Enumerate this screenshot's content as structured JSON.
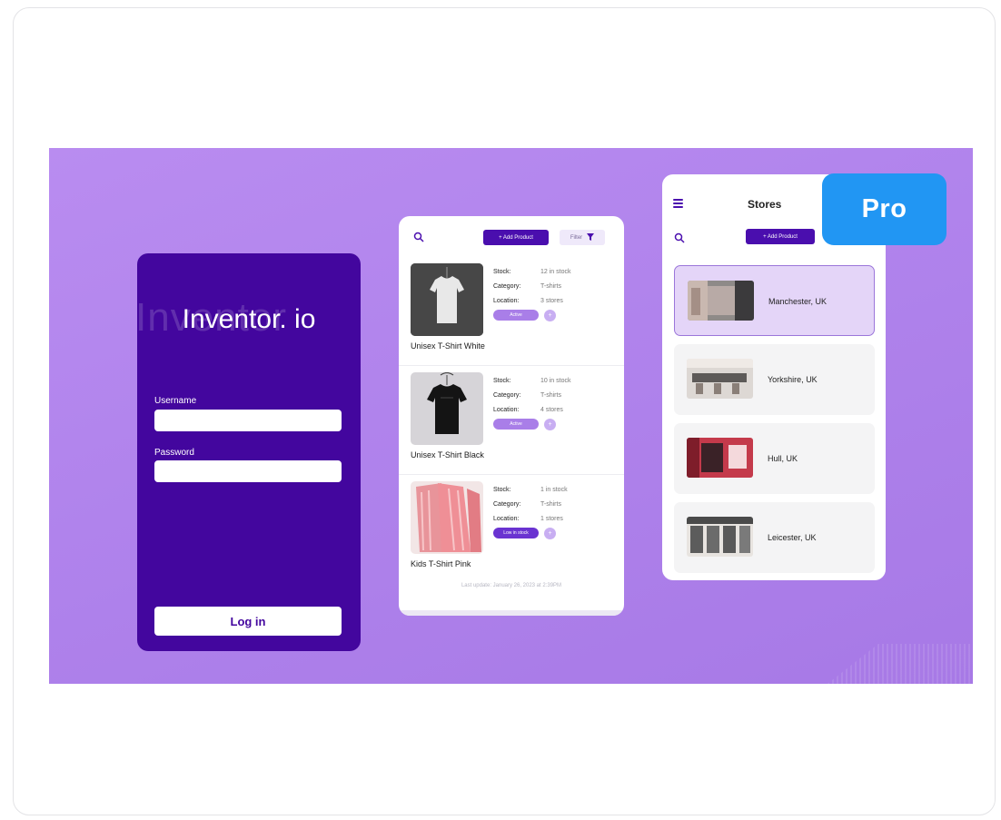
{
  "badge": {
    "label": "Pro"
  },
  "colors": {
    "banner": "#b083ec",
    "primary": "#43069e",
    "accent": "#4a0eae",
    "pro": "#2196f3"
  },
  "login": {
    "watermark": "Inventor",
    "title": "Inventor. io",
    "username_label": "Username",
    "username_value": "",
    "password_label": "Password",
    "password_value": "",
    "login_button": "Log in"
  },
  "products": {
    "search_icon": "search-icon",
    "add_button": "+ Add Product",
    "filter_button": "Filter",
    "filter_icon": "funnel-icon",
    "items": [
      {
        "name": "Unisex T-Shirt White",
        "stock_label": "Stock:",
        "stock": "12 in stock",
        "category_label": "Category:",
        "category": "T-shirts",
        "location_label": "Location:",
        "location": "3 stores",
        "status": "Active",
        "more": "+"
      },
      {
        "name": "Unisex T-Shirt Black",
        "stock_label": "Stock:",
        "stock": "10 in stock",
        "category_label": "Category:",
        "category": "T-shirts",
        "location_label": "Location:",
        "location": "4 stores",
        "status": "Active",
        "more": "+"
      },
      {
        "name": "Kids T-Shirt Pink",
        "stock_label": "Stock:",
        "stock": "1 in stock",
        "category_label": "Category:",
        "category": "T-shirts",
        "location_label": "Location:",
        "location": "1 stores",
        "status": "Low in stock",
        "more": "+"
      }
    ],
    "last_update": "Last update: January 26, 2023 at 2:39PM"
  },
  "stores": {
    "title": "Stores",
    "menu_icon": "hamburger-icon",
    "search_icon": "search-icon",
    "add_button": "+ Add Product",
    "list": [
      {
        "name": "Manchester, UK",
        "selected": true
      },
      {
        "name": "Yorkshire, UK",
        "selected": false
      },
      {
        "name": "Hull, UK",
        "selected": false
      },
      {
        "name": "Leicester, UK",
        "selected": false
      }
    ]
  }
}
